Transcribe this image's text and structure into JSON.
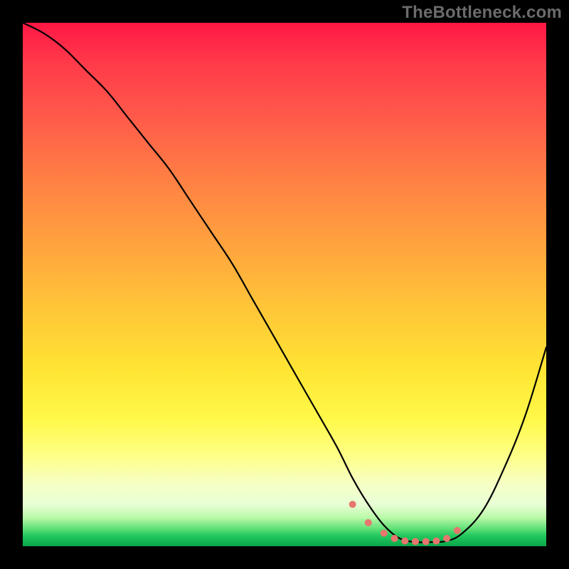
{
  "attribution": "TheBottleneck.com",
  "colors": {
    "background": "#000000",
    "curve": "#000000",
    "accent_points": "#e7766f",
    "attribution_text": "#6b6b6b"
  },
  "chart_data": {
    "type": "line",
    "title": "",
    "xlabel": "",
    "ylabel": "",
    "xlim": [
      0,
      100
    ],
    "ylim": [
      0,
      100
    ],
    "grid": false,
    "legend": null,
    "series": [
      {
        "name": "bottleneck-curve",
        "x": [
          0,
          4,
          8,
          12,
          16,
          20,
          24,
          28,
          32,
          36,
          40,
          44,
          48,
          52,
          56,
          60,
          63,
          66,
          69,
          72,
          75,
          78,
          81,
          84,
          88,
          92,
          96,
          100
        ],
        "y": [
          100,
          98,
          95,
          91,
          87,
          82,
          77,
          72,
          66,
          60,
          54,
          47,
          40,
          33,
          26,
          19,
          13,
          8,
          4,
          1.5,
          0.8,
          0.8,
          1.0,
          2.5,
          7,
          15,
          25,
          38
        ]
      }
    ],
    "accent_points": {
      "name": "valley-markers",
      "x": [
        63,
        66,
        69,
        71,
        73,
        75,
        77,
        79,
        81,
        83
      ],
      "y": [
        8,
        4.5,
        2.5,
        1.5,
        1.0,
        0.9,
        0.9,
        1.0,
        1.5,
        3.0
      ]
    }
  }
}
